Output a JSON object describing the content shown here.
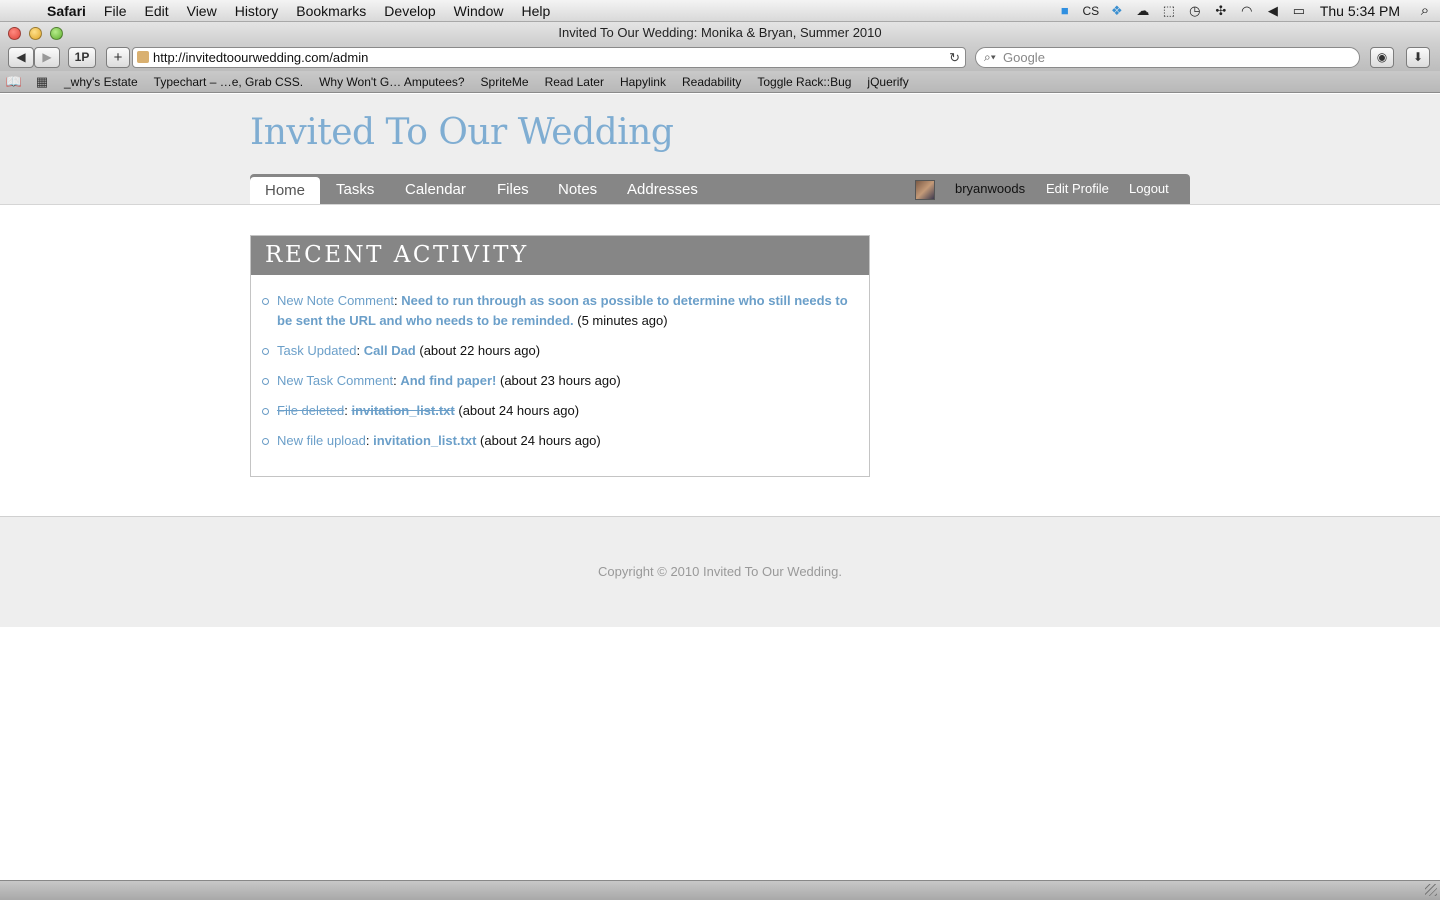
{
  "menubar": {
    "app": "Safari",
    "items": [
      "File",
      "Edit",
      "View",
      "History",
      "Bookmarks",
      "Develop",
      "Window",
      "Help"
    ],
    "clock": "Thu 5:34 PM",
    "status_icons": [
      "cs-icon",
      "dropbox-icon",
      "cloud-icon",
      "screen-icon",
      "time-machine-icon",
      "bluetooth-icon",
      "wifi-icon",
      "volume-icon",
      "battery-icon"
    ],
    "cs_label": "CS"
  },
  "window": {
    "title": "Invited To Our Wedding: Monika & Bryan, Summer 2010"
  },
  "toolbar": {
    "back": "◀",
    "forward": "▶",
    "onepassword": "1P",
    "add": "+",
    "url": "http://invitedtoourwedding.com/admin",
    "search_placeholder": "Google"
  },
  "bookmarks": [
    "_why's Estate",
    "Typechart – …e, Grab CSS.",
    "Why Won't G… Amputees?",
    "SpriteMe",
    "Read Later",
    "Hapylink",
    "Readability",
    "Toggle Rack::Bug",
    "jQuerify"
  ],
  "site": {
    "title": "Invited To Our Wedding",
    "nav": [
      "Home",
      "Tasks",
      "Calendar",
      "Files",
      "Notes",
      "Addresses"
    ],
    "active_tab": "Home",
    "user": {
      "name": "bryanwoods",
      "edit_profile": "Edit Profile",
      "logout": "Logout"
    }
  },
  "recent_activity": {
    "heading": "RECENT ACTIVITY",
    "items": [
      {
        "kind": "New Note Comment",
        "target": "Need to run through as soon as possible to determine who still needs to be sent the URL and who needs to be reminded.",
        "time": "(5 minutes ago)"
      },
      {
        "kind": "Task Updated",
        "target": "Call Dad",
        "time": "(about 22 hours ago)"
      },
      {
        "kind": "New Task Comment",
        "target": "And find paper!",
        "time": "(about 23 hours ago)"
      },
      {
        "kind": "File deleted",
        "target": "invitation_list.txt",
        "time": "(about 24 hours ago)"
      },
      {
        "kind": "New file upload",
        "target": "invitation_list.txt",
        "time": "(about 24 hours ago)"
      }
    ]
  },
  "footer": {
    "copyright": "Copyright © 2010 Invited To Our Wedding."
  },
  "colors": {
    "brand": "#7fadd2",
    "nav_bg": "#868686",
    "band_bg": "#eeeeee"
  }
}
